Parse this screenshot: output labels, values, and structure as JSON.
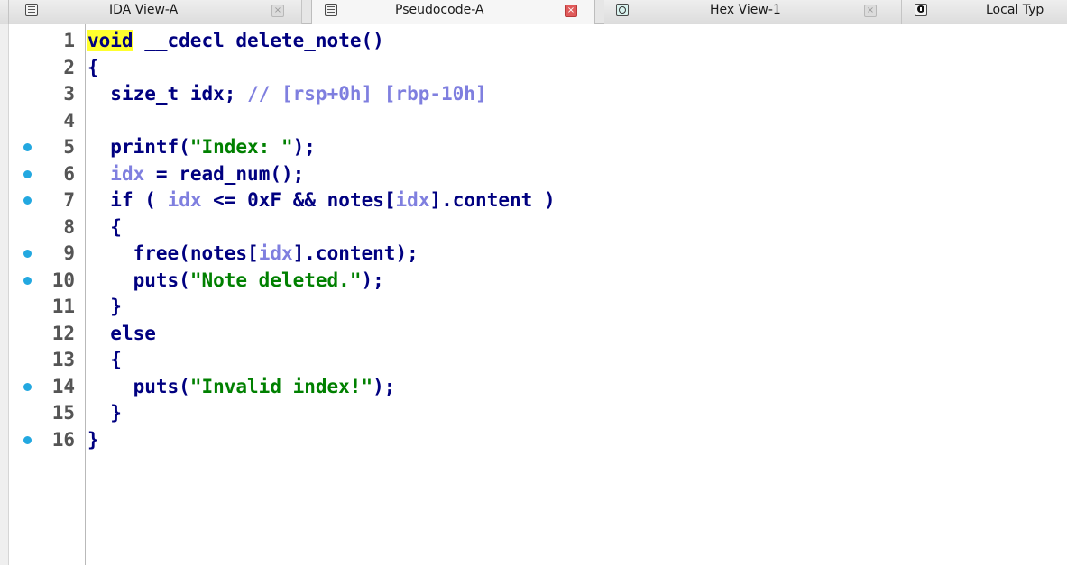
{
  "tabs": [
    {
      "label": "IDA View-A",
      "icon": "doc-icon",
      "active": false
    },
    {
      "label": "Pseudocode-A",
      "icon": "doc-icon",
      "active": true
    },
    {
      "label": "Hex View-1",
      "icon": "hex-view-icon",
      "active": false
    },
    {
      "label": "Local Typ",
      "icon": "info-icon",
      "active": false
    }
  ],
  "colors": {
    "keyword": "#000080",
    "variable": "#7f7fdf",
    "string": "#008000",
    "comment": "#7f7fdf",
    "highlight": "#ffff2e",
    "breakpoint": "#23a8e0"
  },
  "code": {
    "lines": [
      {
        "num": "1",
        "bp": false,
        "tokens": [
          [
            "kw-hl",
            "void"
          ],
          [
            "ws",
            " "
          ],
          [
            "kw",
            "__cdecl"
          ],
          [
            "ws",
            " "
          ],
          [
            "id",
            "delete_note"
          ],
          [
            "p",
            "()"
          ]
        ]
      },
      {
        "num": "2",
        "bp": false,
        "tokens": [
          [
            "p",
            "{"
          ]
        ]
      },
      {
        "num": "3",
        "bp": false,
        "tokens": [
          [
            "ws",
            "  "
          ],
          [
            "kw",
            "size_t"
          ],
          [
            "ws",
            " "
          ],
          [
            "id",
            "idx"
          ],
          [
            "p",
            ";"
          ],
          [
            "ws",
            " "
          ],
          [
            "cmt",
            "// [rsp+0h] [rbp-10h]"
          ]
        ]
      },
      {
        "num": "4",
        "bp": false,
        "tokens": []
      },
      {
        "num": "5",
        "bp": true,
        "tokens": [
          [
            "ws",
            "  "
          ],
          [
            "id",
            "printf"
          ],
          [
            "p",
            "("
          ],
          [
            "str",
            "\"Index: \""
          ],
          [
            "p",
            ");"
          ]
        ]
      },
      {
        "num": "6",
        "bp": true,
        "tokens": [
          [
            "ws",
            "  "
          ],
          [
            "var",
            "idx"
          ],
          [
            "ws",
            " "
          ],
          [
            "p",
            "="
          ],
          [
            "ws",
            " "
          ],
          [
            "id",
            "read_num"
          ],
          [
            "p",
            "();"
          ]
        ]
      },
      {
        "num": "7",
        "bp": true,
        "tokens": [
          [
            "ws",
            "  "
          ],
          [
            "kw",
            "if"
          ],
          [
            "ws",
            " "
          ],
          [
            "p",
            "("
          ],
          [
            "ws",
            " "
          ],
          [
            "var",
            "idx"
          ],
          [
            "ws",
            " "
          ],
          [
            "p",
            "<="
          ],
          [
            "ws",
            " "
          ],
          [
            "num",
            "0xF"
          ],
          [
            "ws",
            " "
          ],
          [
            "p",
            "&&"
          ],
          [
            "ws",
            " "
          ],
          [
            "id",
            "notes"
          ],
          [
            "p",
            "["
          ],
          [
            "var",
            "idx"
          ],
          [
            "p",
            "]."
          ],
          [
            "id",
            "content"
          ],
          [
            "ws",
            " "
          ],
          [
            "p",
            ")"
          ]
        ]
      },
      {
        "num": "8",
        "bp": false,
        "tokens": [
          [
            "ws",
            "  "
          ],
          [
            "p",
            "{"
          ]
        ]
      },
      {
        "num": "9",
        "bp": true,
        "tokens": [
          [
            "ws",
            "    "
          ],
          [
            "id",
            "free"
          ],
          [
            "p",
            "("
          ],
          [
            "id",
            "notes"
          ],
          [
            "p",
            "["
          ],
          [
            "var",
            "idx"
          ],
          [
            "p",
            "]."
          ],
          [
            "id",
            "content"
          ],
          [
            "p",
            ");"
          ]
        ]
      },
      {
        "num": "10",
        "bp": true,
        "tokens": [
          [
            "ws",
            "    "
          ],
          [
            "id",
            "puts"
          ],
          [
            "p",
            "("
          ],
          [
            "str",
            "\"Note deleted.\""
          ],
          [
            "p",
            ");"
          ]
        ]
      },
      {
        "num": "11",
        "bp": false,
        "tokens": [
          [
            "ws",
            "  "
          ],
          [
            "p",
            "}"
          ]
        ]
      },
      {
        "num": "12",
        "bp": false,
        "tokens": [
          [
            "ws",
            "  "
          ],
          [
            "kw",
            "else"
          ]
        ]
      },
      {
        "num": "13",
        "bp": false,
        "tokens": [
          [
            "ws",
            "  "
          ],
          [
            "p",
            "{"
          ]
        ]
      },
      {
        "num": "14",
        "bp": true,
        "tokens": [
          [
            "ws",
            "    "
          ],
          [
            "id",
            "puts"
          ],
          [
            "p",
            "("
          ],
          [
            "str",
            "\"Invalid index!\""
          ],
          [
            "p",
            ");"
          ]
        ]
      },
      {
        "num": "15",
        "bp": false,
        "tokens": [
          [
            "ws",
            "  "
          ],
          [
            "p",
            "}"
          ]
        ]
      },
      {
        "num": "16",
        "bp": true,
        "tokens": [
          [
            "p",
            "}"
          ]
        ]
      }
    ]
  }
}
